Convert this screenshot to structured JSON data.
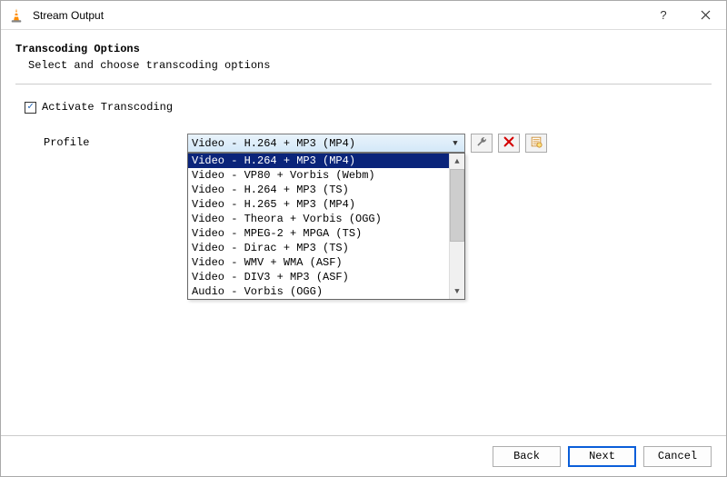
{
  "window": {
    "title": "Stream Output"
  },
  "header": {
    "title": "Transcoding Options",
    "subtitle": "Select and choose transcoding options"
  },
  "activate": {
    "label": "Activate Transcoding",
    "checked": true
  },
  "profile": {
    "label": "Profile",
    "selected": "Video - H.264 + MP3 (MP4)",
    "options": [
      "Video - H.264 + MP3 (MP4)",
      "Video - VP80 + Vorbis (Webm)",
      "Video - H.264 + MP3 (TS)",
      "Video - H.265 + MP3 (MP4)",
      "Video - Theora + Vorbis (OGG)",
      "Video - MPEG-2 + MPGA (TS)",
      "Video - Dirac + MP3 (TS)",
      "Video - WMV + WMA (ASF)",
      "Video - DIV3 + MP3 (ASF)",
      "Audio - Vorbis (OGG)"
    ]
  },
  "footer": {
    "back": "Back",
    "next": "Next",
    "cancel": "Cancel"
  }
}
